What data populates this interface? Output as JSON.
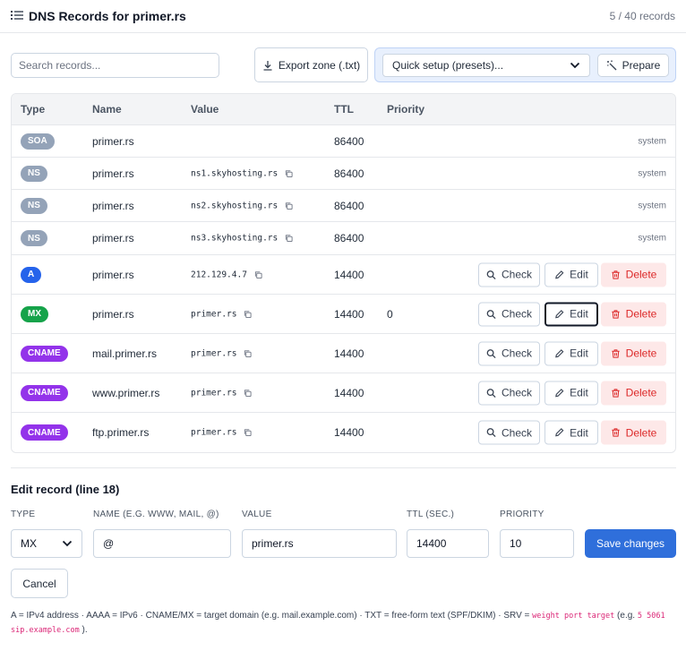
{
  "header": {
    "title": "DNS Records for primer.rs",
    "count": "5 / 40 records"
  },
  "toolbar": {
    "search_placeholder": "Search records...",
    "export_label": "Export zone (.txt)",
    "preset_selected": "Quick setup (presets)...",
    "prepare_label": "Prepare"
  },
  "table": {
    "headers": {
      "type": "Type",
      "name": "Name",
      "value": "Value",
      "ttl": "TTL",
      "priority": "Priority"
    },
    "actions": {
      "check": "Check",
      "edit": "Edit",
      "delete": "Delete",
      "system": "system"
    },
    "rows": [
      {
        "type": "SOA",
        "name": "primer.rs",
        "value": "",
        "ttl": "86400",
        "priority": "",
        "system": true
      },
      {
        "type": "NS",
        "name": "primer.rs",
        "value": "ns1.skyhosting.rs",
        "ttl": "86400",
        "priority": "",
        "system": true
      },
      {
        "type": "NS",
        "name": "primer.rs",
        "value": "ns2.skyhosting.rs",
        "ttl": "86400",
        "priority": "",
        "system": true
      },
      {
        "type": "NS",
        "name": "primer.rs",
        "value": "ns3.skyhosting.rs",
        "ttl": "86400",
        "priority": "",
        "system": true
      },
      {
        "type": "A",
        "name": "primer.rs",
        "value": "212.129.4.7",
        "ttl": "14400",
        "priority": "",
        "system": false
      },
      {
        "type": "MX",
        "name": "primer.rs",
        "value": "primer.rs",
        "ttl": "14400",
        "priority": "0",
        "system": false,
        "editing": true
      },
      {
        "type": "CNAME",
        "name": "mail.primer.rs",
        "value": "primer.rs",
        "ttl": "14400",
        "priority": "",
        "system": false
      },
      {
        "type": "CNAME",
        "name": "www.primer.rs",
        "value": "primer.rs",
        "ttl": "14400",
        "priority": "",
        "system": false
      },
      {
        "type": "CNAME",
        "name": "ftp.primer.rs",
        "value": "primer.rs",
        "ttl": "14400",
        "priority": "",
        "system": false
      }
    ]
  },
  "badge_colors": {
    "SOA": "#94a3b8",
    "NS": "#94a3b8",
    "A": "#2563eb",
    "MX": "#16a34a",
    "CNAME": "#9333ea"
  },
  "edit": {
    "title": "Edit record (line 18)",
    "labels": {
      "type": "TYPE",
      "name": "NAME (E.G. WWW, MAIL, @)",
      "value": "VALUE",
      "ttl": "TTL (SEC.)",
      "priority": "PRIORITY"
    },
    "type_value": "MX",
    "name_value": "@",
    "value_value": "primer.rs",
    "ttl_value": "14400",
    "priority_value": "10",
    "save_label": "Save changes",
    "cancel_label": "Cancel"
  },
  "help": {
    "text": "A = IPv4 address · AAAA = IPv6 · CNAME/MX = target domain (e.g. mail.example.com) · TXT = free-form text (SPF/DKIM) · SRV = ",
    "code1": "weight port target",
    "mid": " (e.g. ",
    "code2": "5 5061 sip.example.com",
    "end": " )."
  },
  "colors": {
    "accent": "#2f6fdb",
    "danger": "#dc2626",
    "danger_bg": "#fde8e8",
    "preset_bg": "#e8f0fd"
  }
}
